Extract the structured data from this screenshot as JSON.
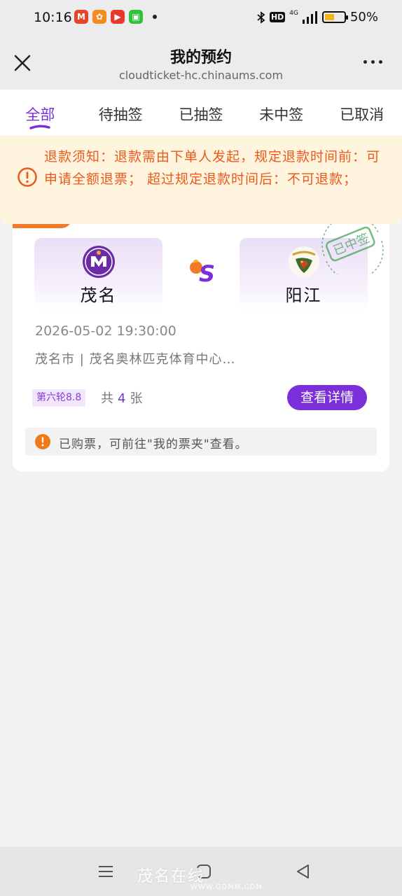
{
  "status_bar": {
    "time": "10:16",
    "app_icons": [
      {
        "name": "mcdonalds-app-icon",
        "glyph": "M",
        "color": "#e8442c"
      },
      {
        "name": "orange-app-icon",
        "glyph": "✿",
        "color": "#f58a1f"
      },
      {
        "name": "video-app-icon",
        "glyph": "▶",
        "color": "#e6382c"
      },
      {
        "name": "green-app-icon",
        "glyph": "▣",
        "color": "#2fc23c"
      }
    ],
    "network": "4G",
    "battery": "50%",
    "battery_level": 0.5
  },
  "header": {
    "title": "我的预约",
    "url": "cloudticket-hc.chinaums.com"
  },
  "tabs": [
    {
      "label": "全部",
      "active": true
    },
    {
      "label": "待抽签",
      "active": false
    },
    {
      "label": "已抽签",
      "active": false
    },
    {
      "label": "未中签",
      "active": false
    },
    {
      "label": "已取消",
      "active": false
    }
  ],
  "notice": {
    "text": "退款须知：退款需由下单人发起，规定退款时间前：可申请全额退票； 超过规定退款时间后：不可退款；"
  },
  "card": {
    "home_team": "茂名",
    "away_team": "阳江",
    "stamp": "已中签",
    "datetime": "2026-05-02 19:30:00",
    "venue": "茂名市 | 茂名奥林匹克体育中心…",
    "round": "第六轮8.8",
    "count_prefix": "共",
    "count": "4",
    "count_suffix": "张",
    "detail_button": "查看详情",
    "tip": "已购票，可前往\"我的票夹\"查看。"
  },
  "watermark": {
    "text": "茂名在线",
    "sub": "WWW.GDMM.COM"
  },
  "colors": {
    "accent": "#7a2fd8",
    "notice_text": "#ea5a1c",
    "notice_bg": "#fff5df",
    "tag_orange": "#ee7a2a"
  }
}
